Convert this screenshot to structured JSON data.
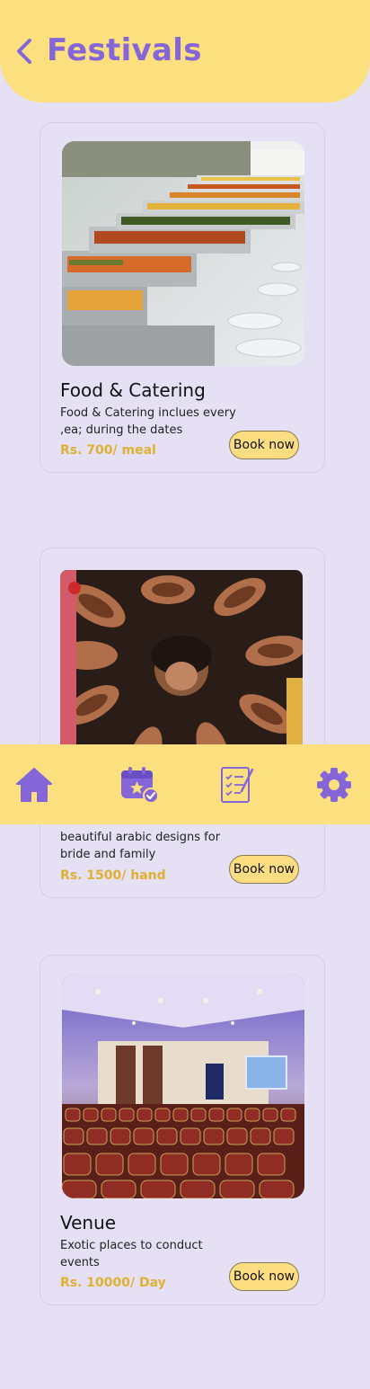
{
  "header": {
    "title": "Festivals",
    "back_icon": "chevron-left-icon"
  },
  "colors": {
    "header_bg": "#fce07f",
    "accent": "#8466d8",
    "page_bg": "#e6e0f5",
    "price": "#e0b033"
  },
  "services": [
    {
      "title": "Food & Catering",
      "description": "Food & Catering inclues every ,ea; during the dates",
      "price": "Rs. 700/ meal",
      "button_label": "Book now"
    },
    {
      "title": "",
      "description": "beautiful arabic designs for bride and family",
      "price": "Rs. 1500/ hand",
      "button_label": "Book now"
    },
    {
      "title": "Venue",
      "description": "Exotic places to conduct events",
      "price": "Rs. 10000/ Day",
      "button_label": "Book now"
    }
  ],
  "bottom_nav": {
    "items": [
      {
        "icon": "home-icon"
      },
      {
        "icon": "calendar-check-icon"
      },
      {
        "icon": "checklist-icon"
      },
      {
        "icon": "gear-icon"
      }
    ]
  }
}
